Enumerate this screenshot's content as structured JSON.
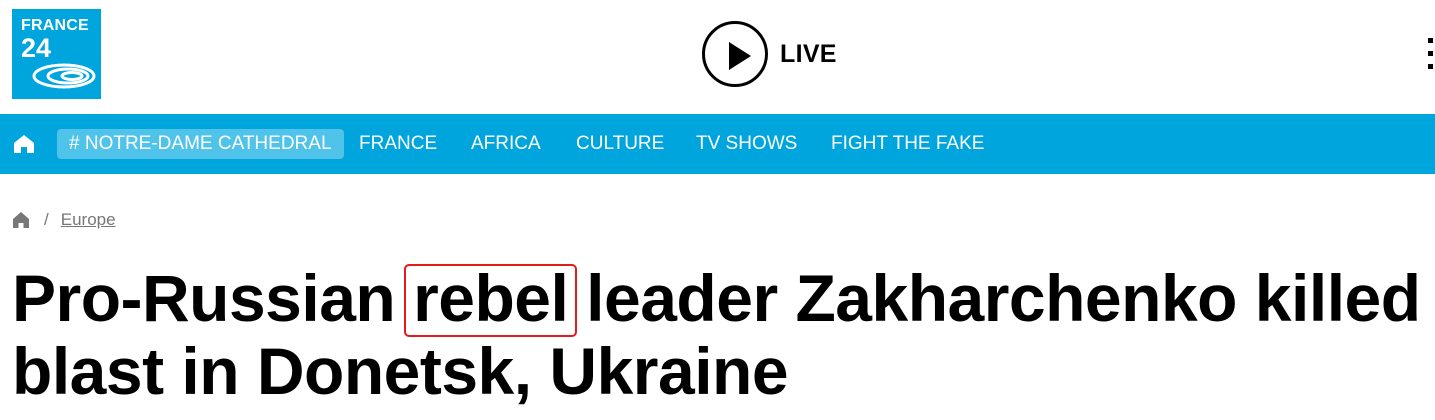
{
  "header": {
    "logo": {
      "line1": "FRANCE",
      "line2": "24",
      "color": "#00a5de"
    },
    "live_label": "LIVE"
  },
  "nav": {
    "background": "#00a5de",
    "home_icon": "home-icon",
    "tag": "# NOTRE-DAME CATHEDRAL",
    "items": [
      "FRANCE",
      "AFRICA",
      "CULTURE",
      "TV SHOWS",
      "FIGHT THE FAKE"
    ]
  },
  "breadcrumb": {
    "home_icon": "home-icon",
    "separator": "/",
    "link": "Europe"
  },
  "article": {
    "headline_before": "Pro-Russian ",
    "headline_highlight": "rebel",
    "headline_after_line1": " leader Zakharchenko killed in",
    "headline_line2": "blast in Donetsk, Ukraine",
    "highlight_color": "#e41b1b"
  }
}
